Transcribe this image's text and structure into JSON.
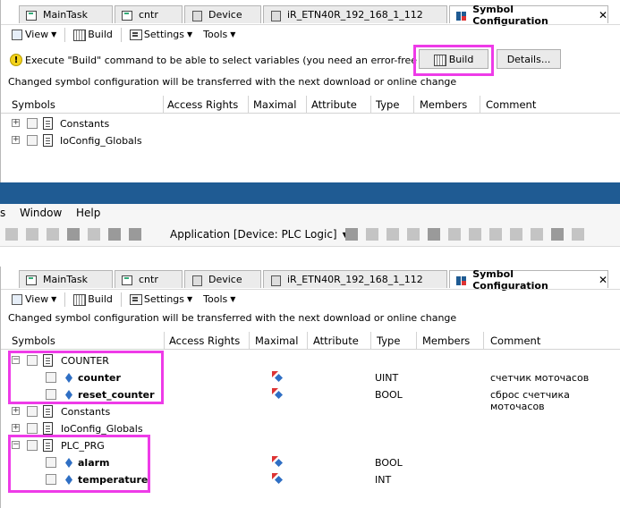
{
  "tabs": [
    {
      "label": "MainTask",
      "icon": "program-icon"
    },
    {
      "label": "cntr",
      "icon": "program-icon"
    },
    {
      "label": "Device",
      "icon": "device-icon"
    },
    {
      "label": "iR_ETN40R_192_168_1_112",
      "icon": "device-icon"
    },
    {
      "label": "Symbol Configuration",
      "icon": "symbol-config-icon",
      "close": "✕"
    }
  ],
  "subtoolbar": {
    "view_label": "View",
    "build_label": "Build",
    "settings_label": "Settings",
    "tools_label": "Tools"
  },
  "infobar": {
    "message": "Execute \"Build\" command to be able to select variables (you need an error-free build).",
    "build_button": "Build",
    "details_button": "Details..."
  },
  "notice": "Changed symbol configuration will be transferred with the next download or online change",
  "columns": [
    "Symbols",
    "Access Rights",
    "Maximal",
    "Attribute",
    "Type",
    "Members",
    "Comment"
  ],
  "top_rows": [
    {
      "name": "Constants"
    },
    {
      "name": "IoConfig_Globals"
    }
  ],
  "menubar": {
    "partial": "s",
    "window": "Window",
    "help": "Help"
  },
  "app_selector": "Application [Device: PLC Logic]",
  "bottom_rows": [
    {
      "name": "COUNTER",
      "type": "",
      "comment": ""
    },
    {
      "name": "counter",
      "type": "UINT",
      "comment": "счетчик моточасов"
    },
    {
      "name": "reset_counter",
      "type": "BOOL",
      "comment": "сброс счетчика моточасов"
    },
    {
      "name": "Constants",
      "type": "",
      "comment": ""
    },
    {
      "name": "IoConfig_Globals",
      "type": "",
      "comment": ""
    },
    {
      "name": "PLC_PRG",
      "type": "",
      "comment": ""
    },
    {
      "name": "alarm",
      "type": "BOOL",
      "comment": ""
    },
    {
      "name": "temperature",
      "type": "INT",
      "comment": ""
    }
  ],
  "colors": {
    "highlight": "#ee3be8",
    "band": "#1f5b93",
    "var_icon": "#2f6fc4"
  }
}
